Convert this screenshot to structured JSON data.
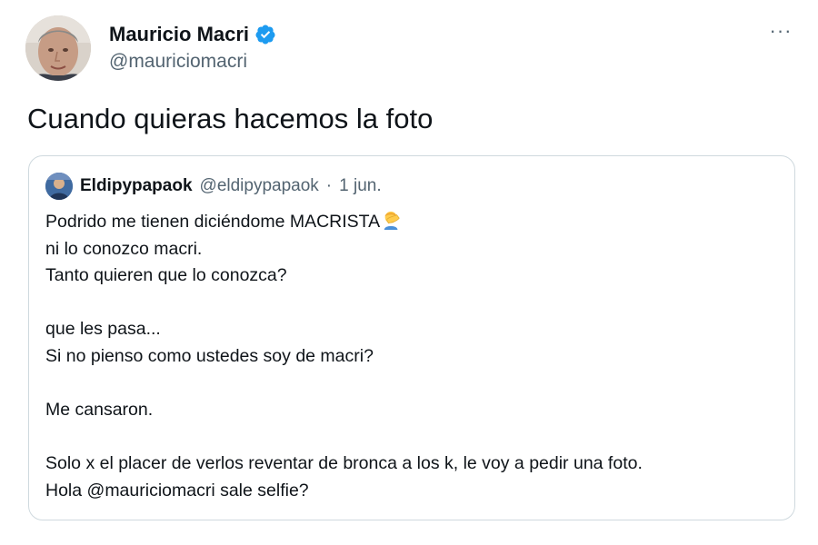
{
  "tweet": {
    "author": {
      "display_name": "Mauricio Macri",
      "handle": "@mauriciomacri",
      "verified": true,
      "avatar_icon": "profile-photo"
    },
    "text": "Cuando quieras hacemos la foto",
    "more_icon": "more-horizontal-icon",
    "more_label": "···"
  },
  "quoted_tweet": {
    "author": {
      "display_name": "Eldipypapaok",
      "handle": "@eldipypapaok",
      "avatar_icon": "profile-photo"
    },
    "separator": "·",
    "date": "1 jun.",
    "lines": [
      "Podrido me tienen diciéndome MACRISTA",
      "ni lo conozco macri.",
      "Tanto quieren que lo conozca?",
      "",
      "que les pasa...",
      "Si no pienso como ustedes soy de macri?",
      "",
      "Me cansaron.",
      "",
      "Solo x el placer de verlos reventar de bronca a los k, le voy a pedir una foto.",
      "Hola @mauriciomacri sale selfie?"
    ],
    "emoji_icon": "facepalm-emoji"
  },
  "colors": {
    "text_primary": "#0f1419",
    "text_secondary": "#536471",
    "border": "#cfd9de",
    "verified_blue": "#1d9bf0"
  }
}
